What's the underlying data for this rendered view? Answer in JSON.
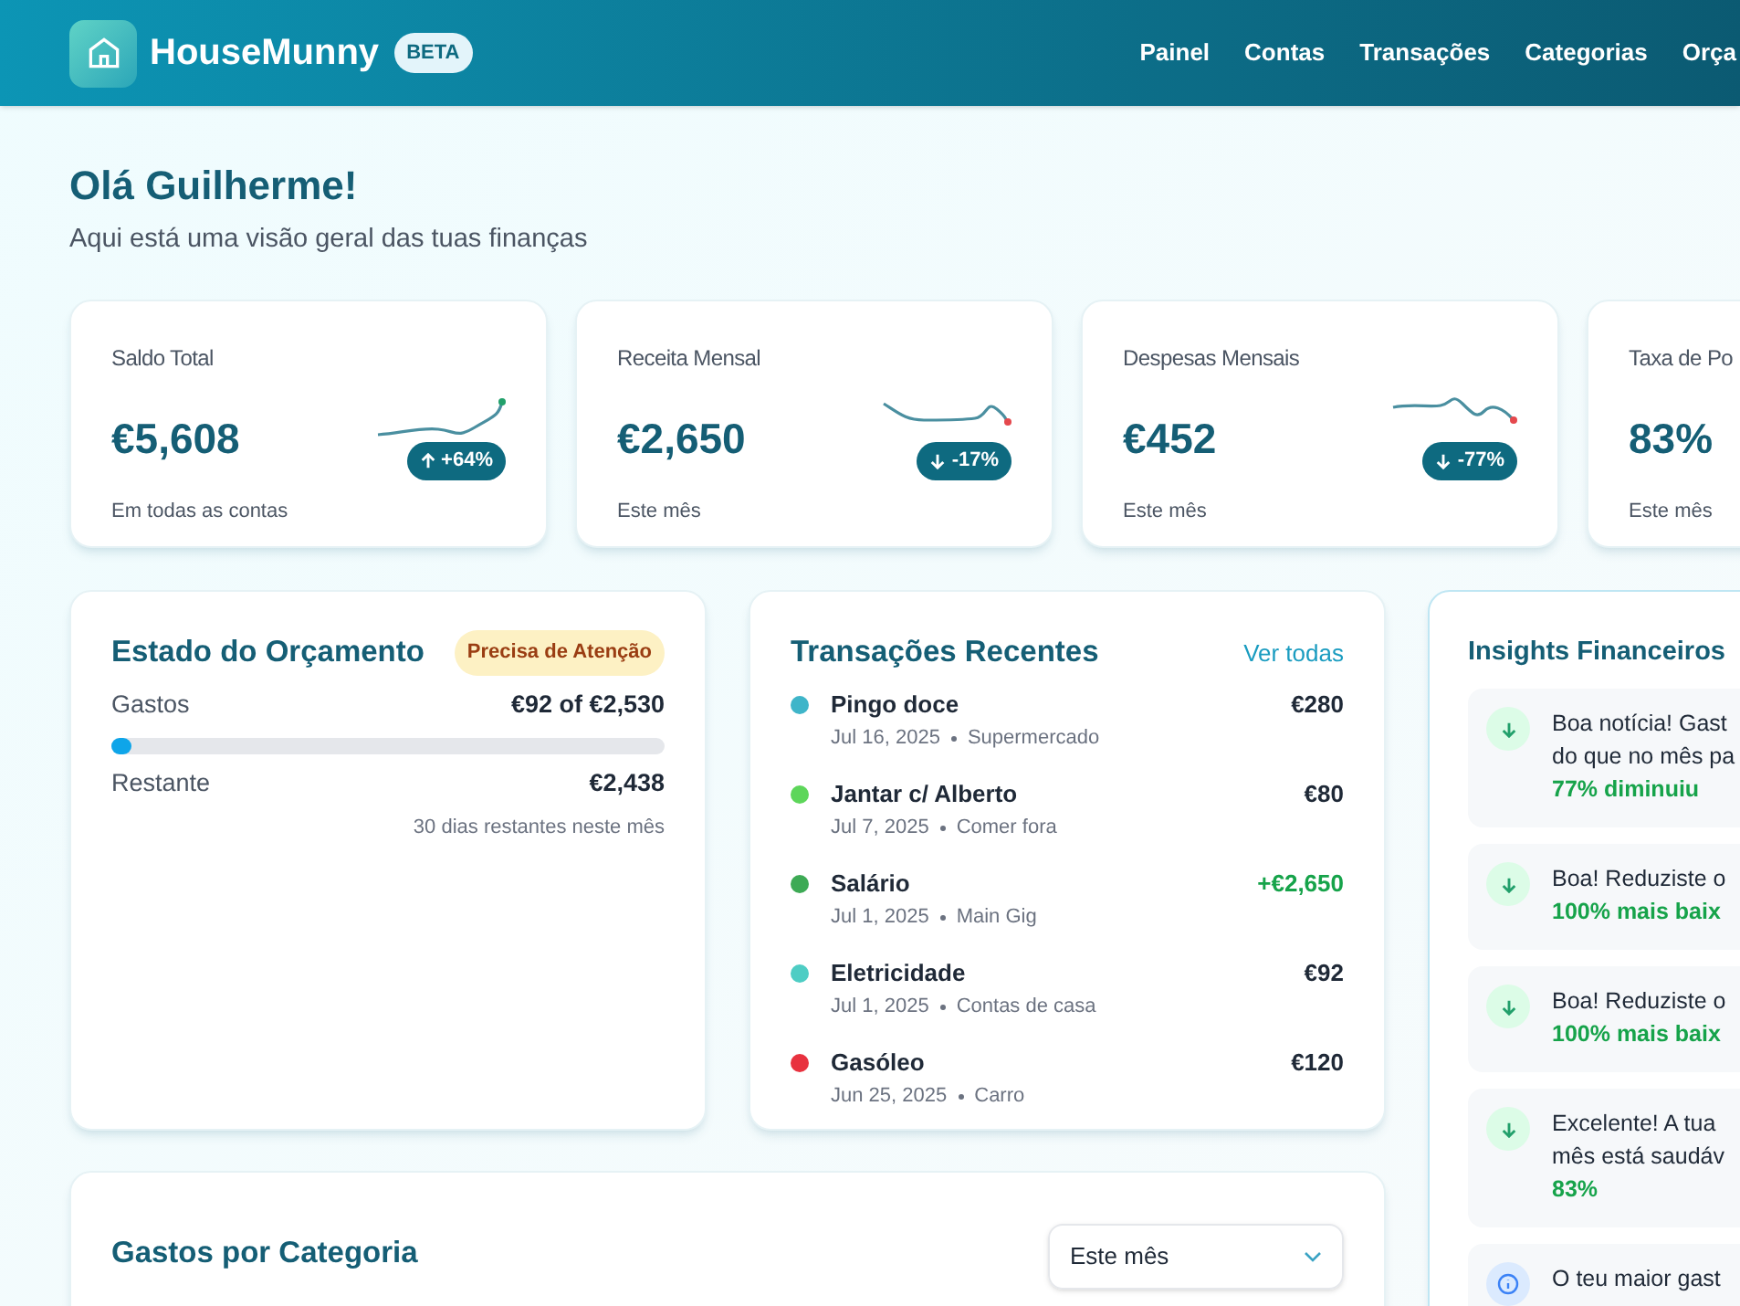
{
  "header": {
    "app_name": "HouseMunny",
    "badge": "BETA",
    "nav": [
      {
        "label": "Painel"
      },
      {
        "label": "Contas"
      },
      {
        "label": "Transações"
      },
      {
        "label": "Categorias"
      },
      {
        "label": "Orça"
      }
    ]
  },
  "greeting": {
    "title": "Olá Guilherme!",
    "subtitle": "Aqui está uma visão geral das tuas finanças"
  },
  "stats": [
    {
      "label": "Saldo Total",
      "value": "€5,608",
      "note": "Em todas as contas",
      "kind": "rise",
      "trend": {
        "kind": "up",
        "text": "+64%"
      }
    },
    {
      "label": "Receita Mensal",
      "value": "€2,650",
      "note": "Este mês",
      "kind": "dip",
      "trend": {
        "kind": "down",
        "text": "-17%"
      }
    },
    {
      "label": "Despesas Mensais",
      "value": "€452",
      "note": "Este mês",
      "kind": "wave",
      "trend": {
        "kind": "down",
        "text": "-77%"
      }
    },
    {
      "label": "Taxa de Po",
      "value": "83%",
      "note": "Este mês",
      "kind": "plain"
    }
  ],
  "budget": {
    "title": "Estado do Orçamento",
    "status": "Precisa de Atenção",
    "spent_label": "Gastos",
    "spent_value": "€92 of €2,530",
    "level": 0.036,
    "remaining_label": "Restante",
    "remaining_value": "€2,438",
    "days_note": "30 dias restantes neste mês"
  },
  "transactions": {
    "title": "Transações Recentes",
    "link": "Ver todas",
    "items": [
      {
        "name": "Pingo doce",
        "date": "Jul 16, 2025",
        "category": "Supermercado",
        "amount": "€280",
        "kind": "expense",
        "color": "#3fb5c9"
      },
      {
        "name": "Jantar c/ Alberto",
        "date": "Jul 7, 2025",
        "category": "Comer fora",
        "amount": "€80",
        "kind": "expense",
        "color": "#5dd65a"
      },
      {
        "name": "Salário",
        "date": "Jul 1, 2025",
        "category": "Main Gig",
        "amount": "+€2,650",
        "kind": "income",
        "color": "#3daa55"
      },
      {
        "name": "Eletricidade",
        "date": "Jul 1, 2025",
        "category": "Contas de casa",
        "amount": "€92",
        "kind": "expense",
        "color": "#4ecdc4"
      },
      {
        "name": "Gasóleo",
        "date": "Jun 25, 2025",
        "category": "Carro",
        "amount": "€120",
        "kind": "expense",
        "color": "#e8323f"
      }
    ]
  },
  "insights": {
    "title": "Insights Financeiros",
    "items": [
      {
        "kind": "down",
        "lines": [
          "Boa notícia! Gast",
          "do que no mês pa"
        ],
        "highlight": "77% diminuiu"
      },
      {
        "kind": "down",
        "lines": [
          "Boa! Reduziste o"
        ],
        "highlight": "100% mais baix"
      },
      {
        "kind": "down",
        "lines": [
          "Boa! Reduziste o"
        ],
        "highlight": "100% mais baix"
      },
      {
        "kind": "down",
        "lines": [
          "Excelente! A tua",
          "mês está saudáv"
        ],
        "highlight": "83%"
      },
      {
        "kind": "info",
        "lines": [
          "O teu maior gast"
        ]
      }
    ]
  },
  "category_spending": {
    "title": "Gastos por Categoria",
    "period": "Este mês"
  }
}
